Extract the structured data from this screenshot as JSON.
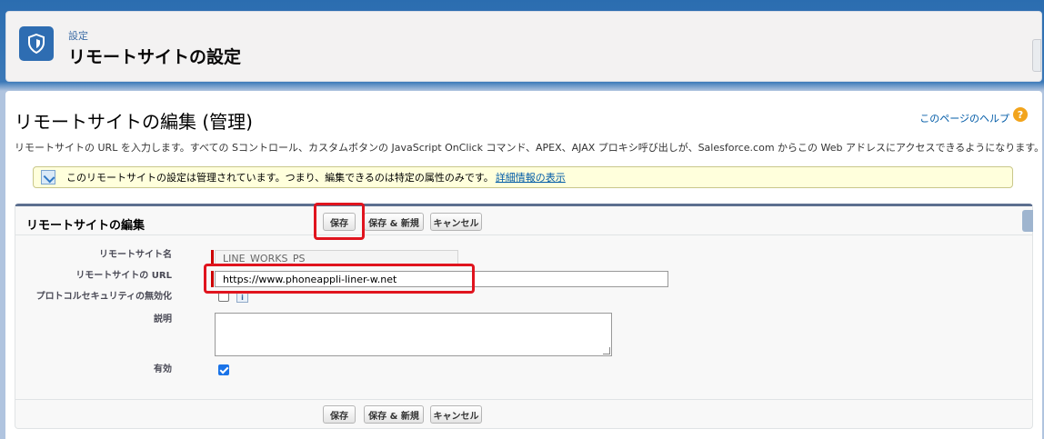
{
  "header": {
    "breadcrumb": "設定",
    "title": "リモートサイトの設定",
    "icon": "shield-icon"
  },
  "page": {
    "title": "リモートサイトの編集 (管理)",
    "help_link": "このページのヘルプ",
    "help_icon": "?",
    "description": "リモートサイトの URL を入力します。すべての Sコントロール、カスタムボタンの JavaScript OnClick コマンド、APEX、AJAX プロキシ呼び出しが、Salesforce.com からこの Web アドレスにアクセスできるようになります。"
  },
  "notice": {
    "text": "このリモートサイトの設定は管理されています。つまり、編集できるのは特定の属性のみです。",
    "link": "詳細情報の表示"
  },
  "section": {
    "title": "リモートサイトの編集",
    "buttons": {
      "save": "保存",
      "save_new": "保存 & 新規",
      "cancel": "キャンセル"
    }
  },
  "form": {
    "name_label": "リモートサイト名",
    "name_value": "LINE_WORKS_PS",
    "url_label": "リモートサイトの URL",
    "url_value": "https://www.phoneappli-liner-w.net",
    "disable_protocol_label": "プロトコルセキュリティの無効化",
    "disable_protocol_checked": false,
    "info_icon": "i",
    "description_label": "説明",
    "description_value": "",
    "active_label": "有効",
    "active_checked": true
  },
  "colors": {
    "highlight": "#e0141e",
    "brand": "#2e6db2"
  }
}
